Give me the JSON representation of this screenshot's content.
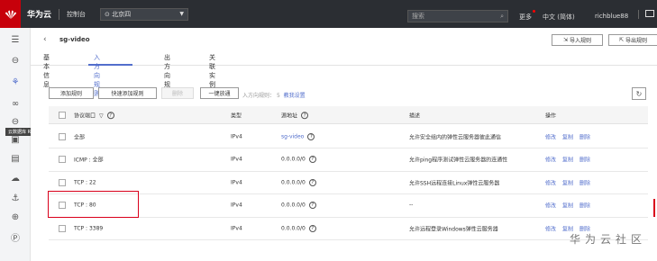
{
  "topbar": {
    "brand": "华为云",
    "console": "控制台",
    "region": "北京四",
    "search_placeholder": "搜索",
    "more": "更多",
    "language": "中文 (简体)",
    "user": "richblue88"
  },
  "sidebar": {
    "tooltip": "云数据库 RDS",
    "icons": [
      "menu-icon",
      "cloud-server-icon",
      "network-icon",
      "database-icon",
      "storage-icon",
      "document-icon",
      "cloud-icon",
      "security-icon",
      "globe-icon",
      "dns-icon"
    ]
  },
  "header": {
    "title": "sg-video",
    "import_label": "导入规则",
    "export_label": "导出规则",
    "tabs": [
      {
        "label": "基本信息",
        "active": false
      },
      {
        "label": "入方向规则",
        "active": true
      },
      {
        "label": "出方向规则",
        "active": false
      },
      {
        "label": "关联实例",
        "active": false
      }
    ]
  },
  "toolbar": {
    "add_rule": "添加规则",
    "quick_add_rule": "快速添加规则",
    "delete": "删除",
    "allow_all": "一键放通",
    "info_prefix": "入方向规则：",
    "info_count": "5",
    "info_link": "教我设置"
  },
  "table": {
    "columns": {
      "protocol": "协议端口",
      "type": "类型",
      "source": "源地址",
      "description": "描述",
      "operation": "操作"
    },
    "actions": [
      "修改",
      "复制",
      "删除"
    ],
    "rows": [
      {
        "protocol": "全部",
        "type": "IPv4",
        "source": "sg-video",
        "source_link": true,
        "description": "允许安全组内的弹性云服务器彼此通信"
      },
      {
        "protocol": "ICMP : 全部",
        "type": "IPv4",
        "source": "0.0.0.0/0",
        "source_link": false,
        "description": "允许ping程序测试弹性云服务器的连通性"
      },
      {
        "protocol": "TCP : 22",
        "type": "IPv4",
        "source": "0.0.0.0/0",
        "source_link": false,
        "description": "允许SSH远程连接Linux弹性云服务器"
      },
      {
        "protocol": "TCP : 80",
        "type": "IPv4",
        "source": "0.0.0.0/0",
        "source_link": false,
        "description": "--"
      },
      {
        "protocol": "TCP : 3389",
        "type": "IPv4",
        "source": "0.0.0.0/0",
        "source_link": false,
        "description": "允许远程登录Windows弹性云服务器"
      }
    ]
  },
  "watermark": "华为云社区",
  "colors": {
    "accent": "#526ecc",
    "topbar": "#2b2e33",
    "highlight": "#d9001b"
  }
}
